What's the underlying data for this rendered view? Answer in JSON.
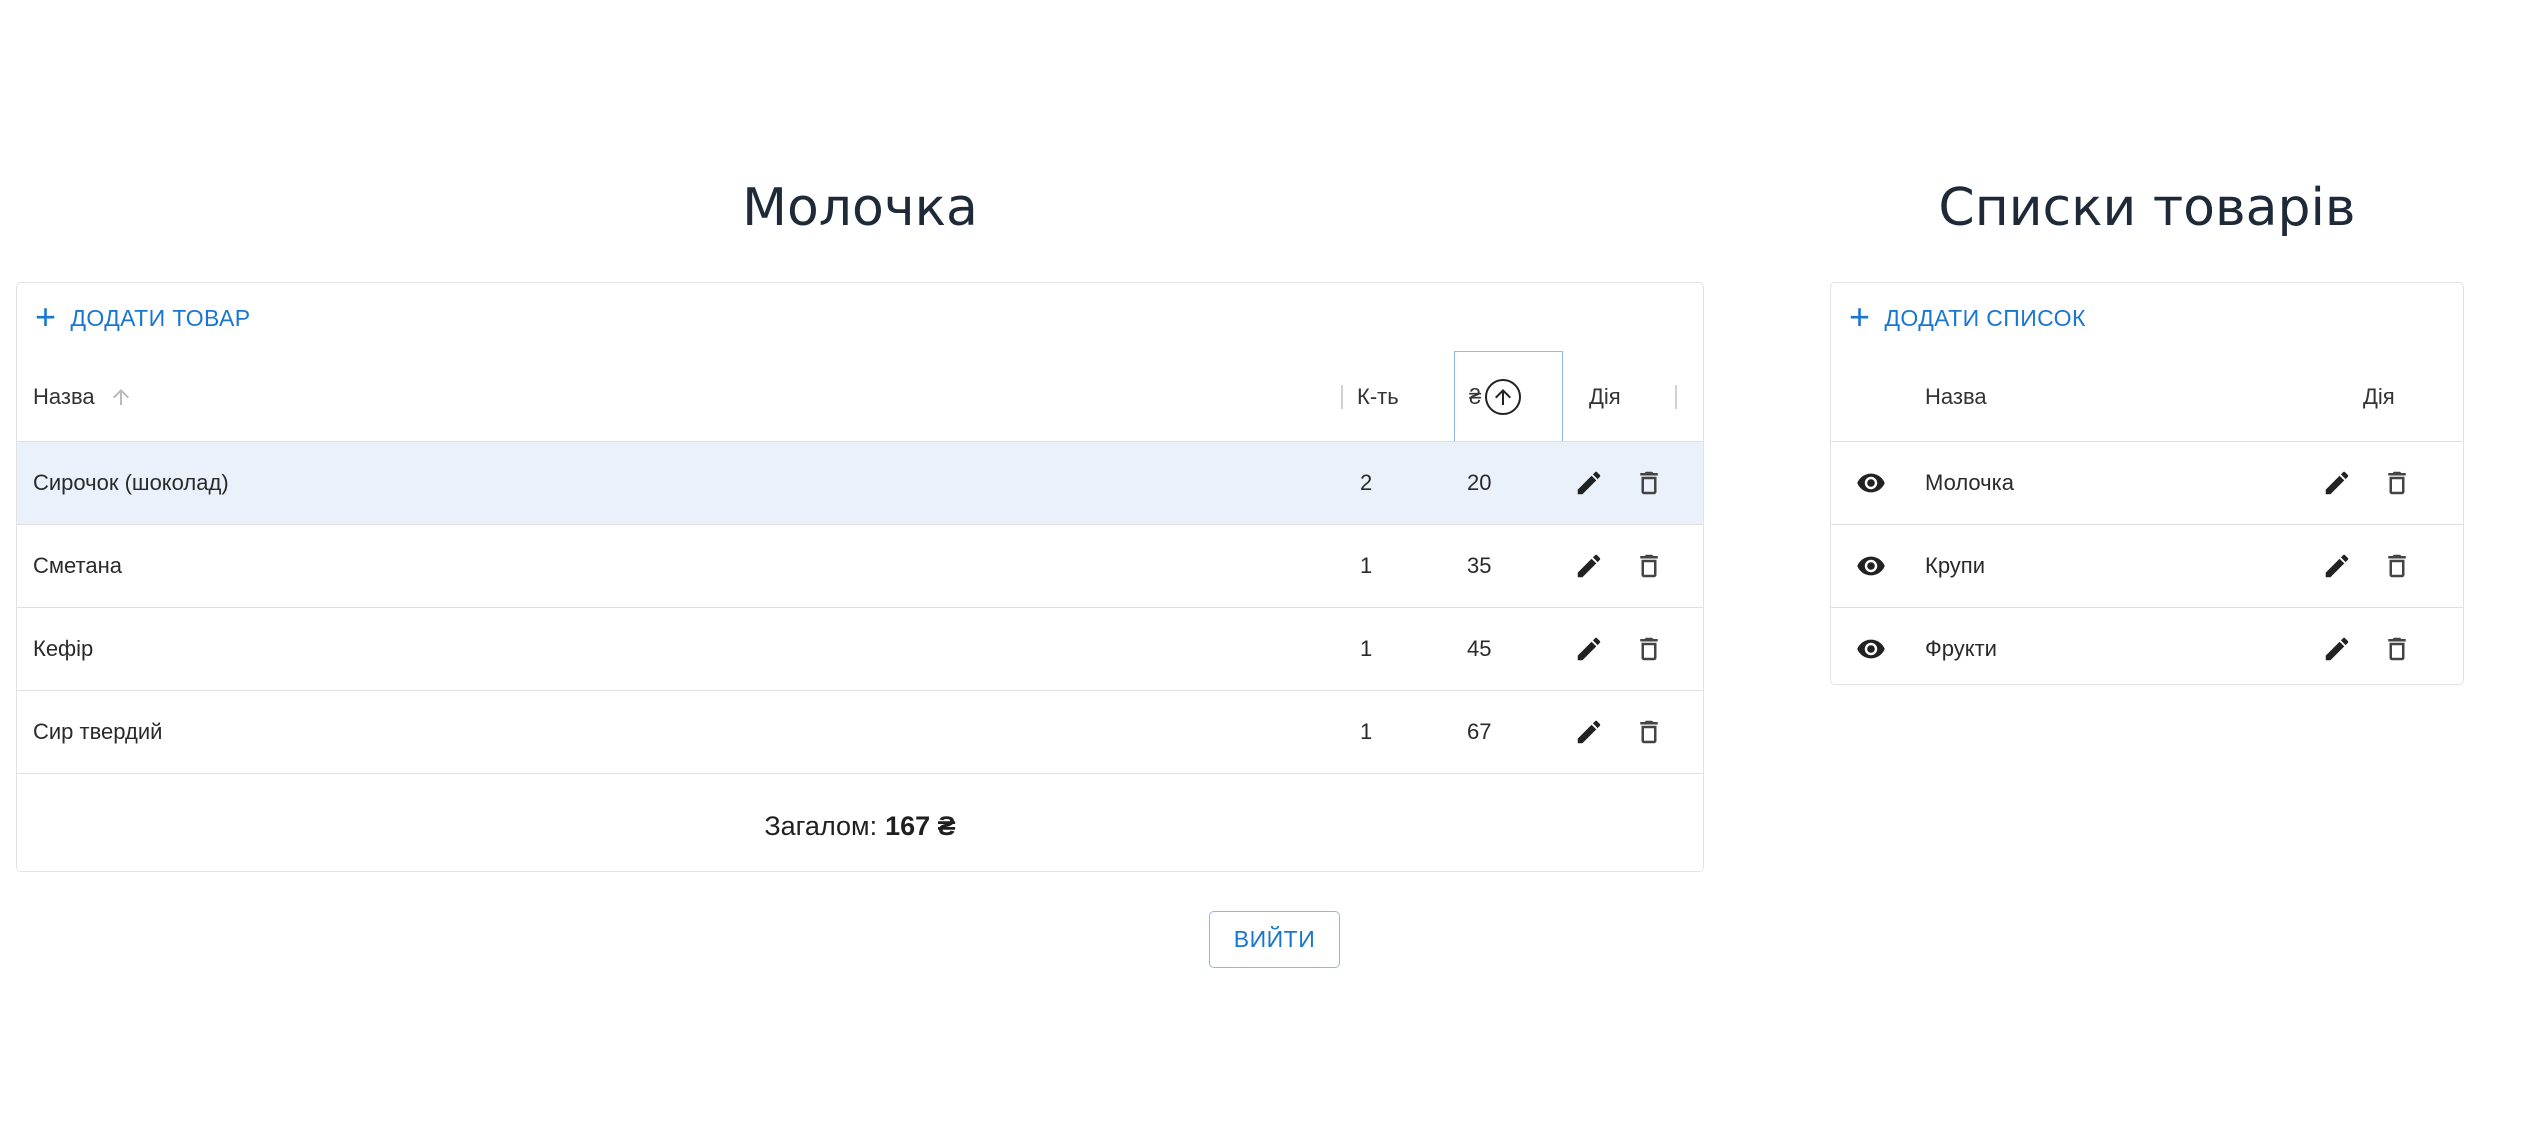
{
  "product_list": {
    "title": "Молочка",
    "add_label": "ДОДАТИ ТОВАР",
    "columns": {
      "name": "Назва",
      "qty": "К-ть",
      "price": "₴",
      "action": "Дія"
    },
    "rows": [
      {
        "name": "Сирочок (шоколад)",
        "qty": "2",
        "price": "20"
      },
      {
        "name": "Сметана",
        "qty": "1",
        "price": "35"
      },
      {
        "name": "Кефір",
        "qty": "1",
        "price": "45"
      },
      {
        "name": "Сир твердий",
        "qty": "1",
        "price": "67"
      }
    ],
    "total_label": "Загалом:",
    "total_value": "167 ₴"
  },
  "lists": {
    "title": "Списки товарів",
    "add_label": "ДОДАТИ СПИСОК",
    "columns": {
      "name": "Назва",
      "action": "Дія"
    },
    "rows": [
      {
        "name": "Молочка"
      },
      {
        "name": "Крупи"
      },
      {
        "name": "Фрукти"
      }
    ]
  },
  "logout_label": "ВИЙТИ",
  "icons": {
    "sort": "arrow-up-icon",
    "edit": "pencil-icon",
    "delete": "trash-icon",
    "view": "eye-icon",
    "add": "plus-icon"
  },
  "colors": {
    "accent": "#1976d2",
    "selected_row": "#ebf1fa",
    "title": "#1e2a38"
  }
}
